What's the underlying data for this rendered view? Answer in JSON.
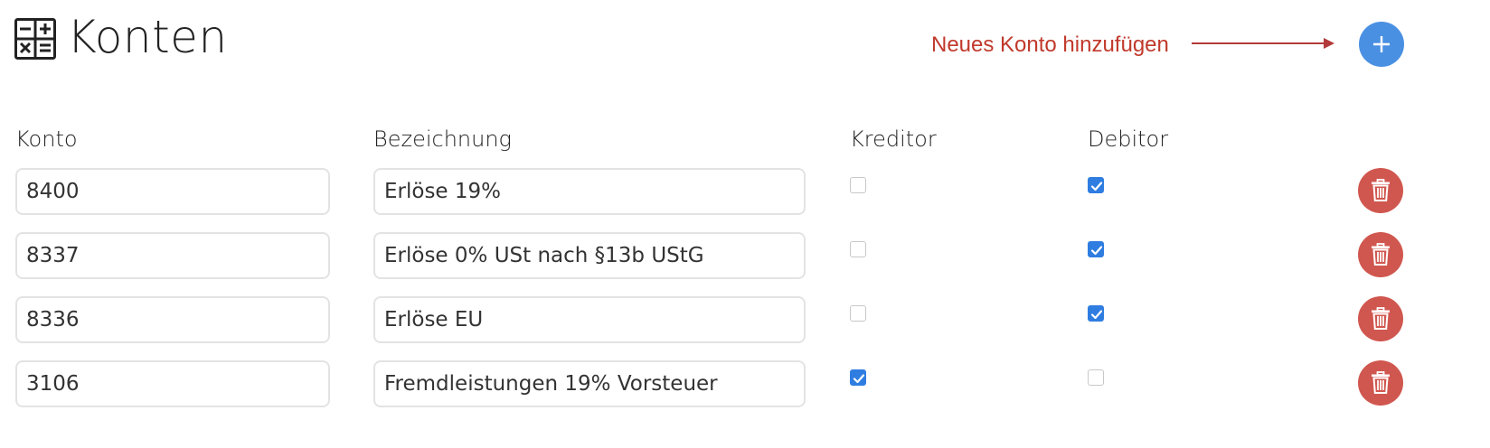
{
  "header": {
    "title": "Konten",
    "hint": "Neues Konto hinzufügen",
    "add_label": "+"
  },
  "columns": {
    "konto": "Konto",
    "bezeichnung": "Bezeichnung",
    "kreditor": "Kreditor",
    "debitor": "Debitor"
  },
  "rows": [
    {
      "konto": "8400",
      "bezeichnung": "Erlöse 19%",
      "kreditor": false,
      "debitor": true
    },
    {
      "konto": "8337",
      "bezeichnung": "Erlöse 0% USt nach §13b UStG",
      "kreditor": false,
      "debitor": true
    },
    {
      "konto": "8336",
      "bezeichnung": "Erlöse EU",
      "kreditor": false,
      "debitor": true
    },
    {
      "konto": "3106",
      "bezeichnung": "Fremdleistungen 19% Vorsteuer",
      "kreditor": true,
      "debitor": false
    }
  ],
  "colors": {
    "accent": "#4a90e2",
    "danger": "#d0574f",
    "hint": "#c0392b",
    "checkbox": "#2f7de1"
  },
  "icons": {
    "page": "calculator-icon",
    "add": "plus-icon",
    "delete": "trash-icon",
    "arrow": "arrow-right-icon"
  }
}
